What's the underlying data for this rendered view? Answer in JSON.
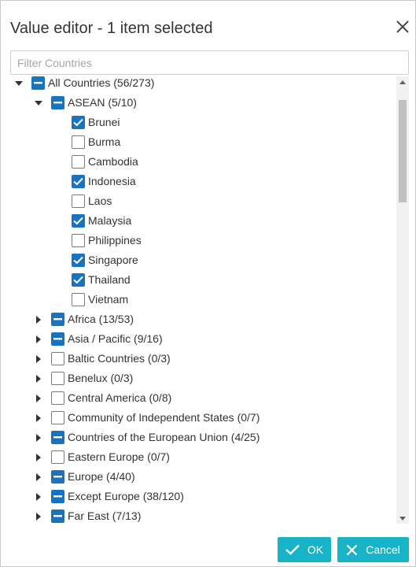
{
  "dialog": {
    "title": "Value editor - 1 item selected",
    "close_icon": "close-icon"
  },
  "filter": {
    "placeholder": "Filter Countries",
    "value": ""
  },
  "tree": {
    "rows": [
      {
        "label": "All Countries (56/273)",
        "level": 0,
        "expander": "expanded",
        "state": "partial"
      },
      {
        "label": "ASEAN (5/10)",
        "level": 1,
        "expander": "expanded",
        "state": "partial"
      },
      {
        "label": "Brunei",
        "level": 2,
        "expander": "none",
        "state": "checked"
      },
      {
        "label": "Burma",
        "level": 2,
        "expander": "none",
        "state": "unchecked"
      },
      {
        "label": "Cambodia",
        "level": 2,
        "expander": "none",
        "state": "unchecked"
      },
      {
        "label": "Indonesia",
        "level": 2,
        "expander": "none",
        "state": "checked"
      },
      {
        "label": "Laos",
        "level": 2,
        "expander": "none",
        "state": "unchecked"
      },
      {
        "label": "Malaysia",
        "level": 2,
        "expander": "none",
        "state": "checked"
      },
      {
        "label": "Philippines",
        "level": 2,
        "expander": "none",
        "state": "unchecked"
      },
      {
        "label": "Singapore",
        "level": 2,
        "expander": "none",
        "state": "checked"
      },
      {
        "label": "Thailand",
        "level": 2,
        "expander": "none",
        "state": "checked"
      },
      {
        "label": "Vietnam",
        "level": 2,
        "expander": "none",
        "state": "unchecked"
      },
      {
        "label": "Africa (13/53)",
        "level": 1,
        "expander": "collapsed",
        "state": "partial"
      },
      {
        "label": "Asia / Pacific (9/16)",
        "level": 1,
        "expander": "collapsed",
        "state": "partial"
      },
      {
        "label": "Baltic Countries (0/3)",
        "level": 1,
        "expander": "collapsed",
        "state": "unchecked"
      },
      {
        "label": "Benelux (0/3)",
        "level": 1,
        "expander": "collapsed",
        "state": "unchecked"
      },
      {
        "label": "Central America (0/8)",
        "level": 1,
        "expander": "collapsed",
        "state": "unchecked"
      },
      {
        "label": "Community of Independent States (0/7)",
        "level": 1,
        "expander": "collapsed",
        "state": "unchecked"
      },
      {
        "label": "Countries of the European Union (4/25)",
        "level": 1,
        "expander": "collapsed",
        "state": "partial"
      },
      {
        "label": "Eastern Europe (0/7)",
        "level": 1,
        "expander": "collapsed",
        "state": "unchecked"
      },
      {
        "label": "Europe (4/40)",
        "level": 1,
        "expander": "collapsed",
        "state": "partial"
      },
      {
        "label": "Except Europe (38/120)",
        "level": 1,
        "expander": "collapsed",
        "state": "partial"
      },
      {
        "label": "Far East (7/13)",
        "level": 1,
        "expander": "collapsed",
        "state": "partial"
      }
    ]
  },
  "footer": {
    "ok_label": "OK",
    "cancel_label": "Cancel"
  },
  "colors": {
    "checkbox_blue": "#1874c1",
    "button_teal": "#17b4c7"
  }
}
